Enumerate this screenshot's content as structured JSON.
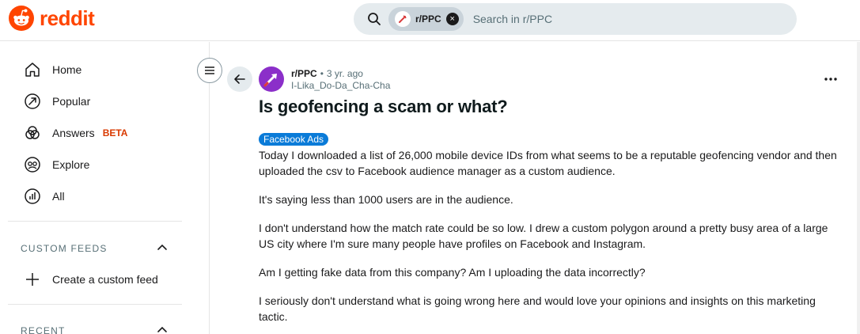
{
  "header": {
    "logo_text": "reddit",
    "brand_color": "#ff4500",
    "search": {
      "chip_label": "r/PPC",
      "chip_close": "×",
      "placeholder": "Search in r/PPC"
    }
  },
  "sidebar": {
    "items": [
      {
        "label": "Home",
        "icon": "home-icon"
      },
      {
        "label": "Popular",
        "icon": "popular-icon"
      },
      {
        "label": "Answers",
        "badge": "BETA",
        "icon": "answers-icon"
      },
      {
        "label": "Explore",
        "icon": "explore-icon"
      },
      {
        "label": "All",
        "icon": "all-icon"
      }
    ],
    "custom_feeds": {
      "title": "CUSTOM FEEDS",
      "create_label": "Create a custom feed"
    },
    "recent": {
      "title": "RECENT"
    }
  },
  "post": {
    "subreddit": "r/PPC",
    "dot": "•",
    "time": "3 yr. ago",
    "author": "I-Lika_Do-Da_Cha-Cha",
    "title": "Is geofencing a scam or what?",
    "flair": "Facebook Ads",
    "flair_color": "#0a7bd8",
    "paragraphs": [
      "Today I downloaded a list of 26,000 mobile device IDs from what seems to be a reputable geofencing vendor and then uploaded the csv to Facebook audience manager as a custom audience.",
      "It's saying less than 1000 users are in the audience.",
      "I don't understand how the match rate could be so low. I drew a custom polygon around a pretty busy area of a large US city where I'm sure many people have profiles on Facebook and Instagram.",
      "Am I getting fake data from this company? Am I uploading the data incorrectly?",
      "I seriously don't understand what is going wrong here and would love your opinions and insights on this marketing tactic."
    ]
  }
}
